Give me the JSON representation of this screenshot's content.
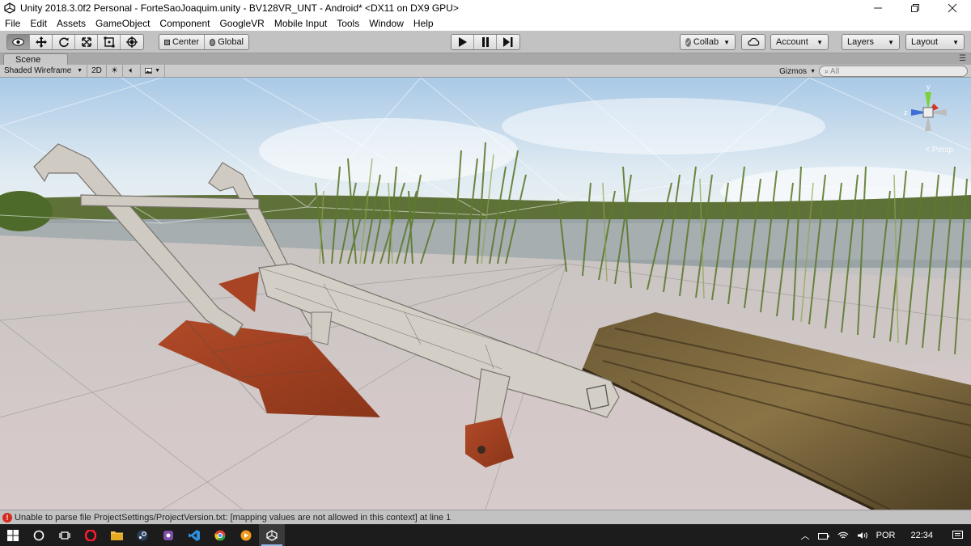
{
  "window": {
    "title": "Unity 2018.3.0f2 Personal - ForteSaoJoaquim.unity - BV128VR_UNT - Android* <DX11 on DX9 GPU>",
    "controls": [
      "minimize",
      "maximize",
      "close"
    ]
  },
  "menu": [
    "File",
    "Edit",
    "Assets",
    "GameObject",
    "Component",
    "GoogleVR",
    "Mobile Input",
    "Tools",
    "Window",
    "Help"
  ],
  "toolbar": {
    "tools": [
      "hand-icon",
      "move-icon",
      "rotate-icon",
      "scale-icon",
      "rect-icon",
      "transform-icon"
    ],
    "pivot_label": "Center",
    "space_label": "Global",
    "collab_label": "Collab",
    "account_label": "Account",
    "layers_label": "Layers",
    "layout_label": "Layout"
  },
  "scene": {
    "tab_label": "Scene",
    "draw_mode": "Shaded Wireframe",
    "mode_2d": "2D",
    "gizmos_label": "Gizmos",
    "search_placeholder": "All",
    "persp_label": "< Persp",
    "axis_y": "y",
    "axis_z": "z"
  },
  "status": {
    "message": "Unable to parse file ProjectSettings/ProjectVersion.txt: [mapping values are not allowed in this context] at line 1"
  },
  "taskbar": {
    "language": "POR",
    "time": "22:34"
  },
  "colors": {
    "sky": "#b9d3e8",
    "ground": "#d2c7c7",
    "error": "#d42b1e",
    "taskbar": "#1c1c1c"
  }
}
